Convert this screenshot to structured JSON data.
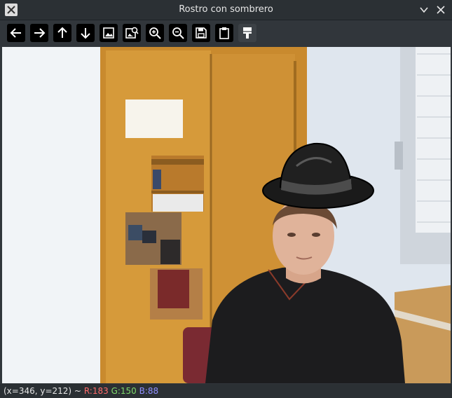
{
  "window": {
    "title": "Rostro con sombrero",
    "controls": [
      "chevron-down-icon",
      "close-icon"
    ]
  },
  "toolbar": {
    "tools": [
      {
        "name": "pan-left",
        "icon": "arrow-left-icon"
      },
      {
        "name": "pan-right",
        "icon": "arrow-right-icon"
      },
      {
        "name": "pan-up",
        "icon": "arrow-up-icon"
      },
      {
        "name": "pan-down",
        "icon": "arrow-down-icon"
      },
      {
        "name": "zoom-fit",
        "icon": "image-icon"
      },
      {
        "name": "zoom-original",
        "icon": "image-zoom-icon"
      },
      {
        "name": "zoom-in",
        "icon": "zoom-in-icon"
      },
      {
        "name": "zoom-out",
        "icon": "zoom-out-icon"
      },
      {
        "name": "save",
        "icon": "save-icon"
      },
      {
        "name": "copy",
        "icon": "clipboard-icon"
      },
      {
        "name": "properties",
        "icon": "properties-icon"
      }
    ]
  },
  "status": {
    "coords": "(x=346, y=212) ~",
    "r": "R:183",
    "g": "G:150",
    "b": "B:88"
  },
  "colors": {
    "r": "#ff6b6b",
    "g": "#7fd96b",
    "b": "#8f8fff"
  }
}
